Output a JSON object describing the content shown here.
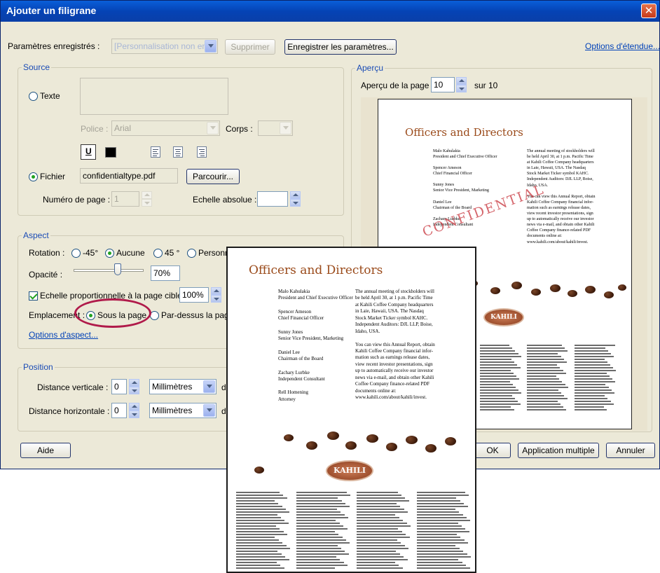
{
  "window": {
    "title": "Ajouter un filigrane",
    "close_glyph": "✕"
  },
  "top": {
    "saved_settings_label": "Paramètres enregistrés :",
    "saved_settings_value": "[Personnalisation non enre",
    "delete_button": "Supprimer",
    "save_settings_button": "Enregistrer les paramètres...",
    "page_range_link": "Options d'étendue..."
  },
  "source": {
    "group_label": "Source",
    "text_radio": "Texte",
    "font_label": "Police :",
    "font_value": "Arial",
    "size_label": "Corps :",
    "underline_glyph": "U",
    "file_radio": "Fichier",
    "file_value": "confidentialtype.pdf",
    "browse_button": "Parcourir...",
    "page_number_label": "Numéro de page :",
    "page_number_value": "1",
    "absolute_scale_label": "Echelle absolue :"
  },
  "appearance": {
    "group_label": "Aspect",
    "rotation_label": "Rotation :",
    "rot_minus45": "-45°",
    "rot_none": "Aucune",
    "rot_45": "45 °",
    "rot_custom": "Personn",
    "opacity_label": "Opacité :",
    "opacity_value": "70%",
    "opacity_fraction": 0.7,
    "scale_checkbox_label": "Echelle proportionnelle à la page cible",
    "scale_value": "100%",
    "location_label": "Emplacement :",
    "behind_page": "Sous la page",
    "on_top": "Par-dessus la page",
    "appearance_options_link": "Options d'aspect..."
  },
  "position": {
    "group_label": "Position",
    "vertical_label": "Distance verticale :",
    "vertical_value": "0",
    "vertical_units": "Millimètres",
    "horizontal_label": "Distance horizontale :",
    "horizontal_value": "0",
    "horizontal_units": "Millimètres",
    "from_truncated": "d"
  },
  "preview": {
    "group_label": "Aperçu",
    "page_preview_label": "Aperçu de la page",
    "page_value": "10",
    "of_total": "sur 10",
    "watermark_text": "CONFIDENTIAL"
  },
  "document": {
    "title": "Officers and Directors",
    "names": [
      {
        "name": "Malo Kahulakia",
        "role": "President and Chief Executive Officer"
      },
      {
        "name": "Spencer Ameson",
        "role": "Chief Financial Officer"
      },
      {
        "name": "Sunny Jones",
        "role": "Senior Vice President, Marketing"
      },
      {
        "name": "Daniel Lee",
        "role": "Chairman of the Board"
      },
      {
        "name": "Zachary Lurbke",
        "role": "Independent Consultant"
      },
      {
        "name": "Rell Homening",
        "role": "Attorney"
      }
    ],
    "right_col": [
      "The annual meeting of stockholders will",
      "be held April 30, at 1 p.m. Pacific Time",
      "at Kahili Coffee Company headquarters",
      "in Laie, Hawaii, USA. The Nasdaq",
      "Stock Market Ticker symbol KAHC.",
      "Independent Auditors: DJL LLP, Boise,",
      "Idaho, USA.",
      "",
      "You can view this Annual Report, obtain",
      "Kahili Coffee Company financial infor-",
      "mation such as earnings release dates,",
      "view recent investor presentations, sign",
      "up to automatically receive our investor",
      "news via e-mail, and obtain other Kahili",
      "Coffee Company finance-related PDF",
      "documents online at:",
      "www.kahili.com/about/kahili/invest."
    ],
    "logo_text": "KAHILI"
  },
  "footer": {
    "help_button": "Aide",
    "ok_button": "OK",
    "batch_button": "Application multiple",
    "cancel_button": "Annuler"
  },
  "colors": {
    "title_bar": "#0a5fd9",
    "dialog_bg": "#ece9d8",
    "link": "#0041b8",
    "highlight_ring": "#b01a4a",
    "watermark": "#c8343c"
  }
}
